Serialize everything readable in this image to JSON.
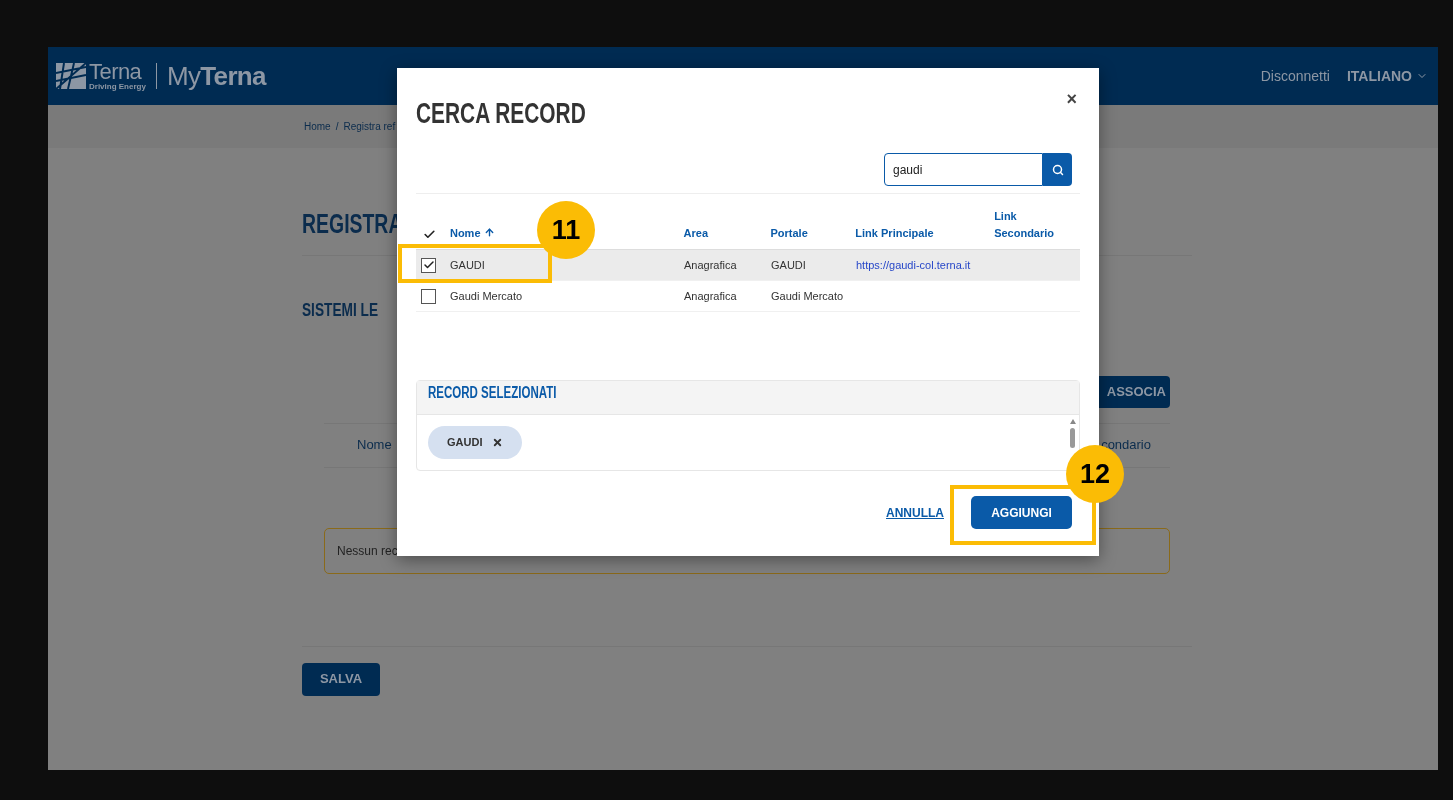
{
  "header": {
    "logo": "Terna",
    "logo_tagline": "Driving Energy",
    "app_prefix": "My",
    "app_name": "Terna",
    "links": [
      "Disconnetti"
    ],
    "language": "ITALIANO"
  },
  "breadcrumb": {
    "items": [
      "Home",
      "Registra ref"
    ],
    "separator": "/"
  },
  "page": {
    "title": "REGISTRA",
    "section_title": "SISTEMI LE",
    "associate_button": "ASSOCIA",
    "table_columns": [
      "Nome",
      "condario"
    ],
    "empty_message": "Nessun rec",
    "save_button": "SALVA"
  },
  "modal": {
    "title": "CERCA RECORD",
    "close": "×",
    "search": {
      "value": "gaudi"
    },
    "columns": [
      {
        "label": "Nome",
        "sorted": true
      },
      {
        "label": "Area",
        "sorted": false
      },
      {
        "label": "Portale",
        "sorted": false
      },
      {
        "label": "Link Principale",
        "sorted": false
      },
      {
        "label": "Link Secondario",
        "sorted": false
      }
    ],
    "rows": [
      {
        "selected": true,
        "checked": true,
        "name": "GAUDI",
        "area": "Anagrafica",
        "portal": "GAUDI",
        "link": "https://gaudi-col.terna.it"
      },
      {
        "selected": false,
        "checked": false,
        "name": "Gaudi Mercato",
        "area": "Anagrafica",
        "portal": "Gaudi Mercato"
      }
    ],
    "selected_panel": {
      "title": "RECORD SELEZIONATI",
      "chips": [
        "GAUDI"
      ]
    },
    "cancel": "ANNULLA",
    "confirm": "AGGIUNGI"
  },
  "callouts": [
    {
      "number": "11"
    },
    {
      "number": "12"
    }
  ]
}
